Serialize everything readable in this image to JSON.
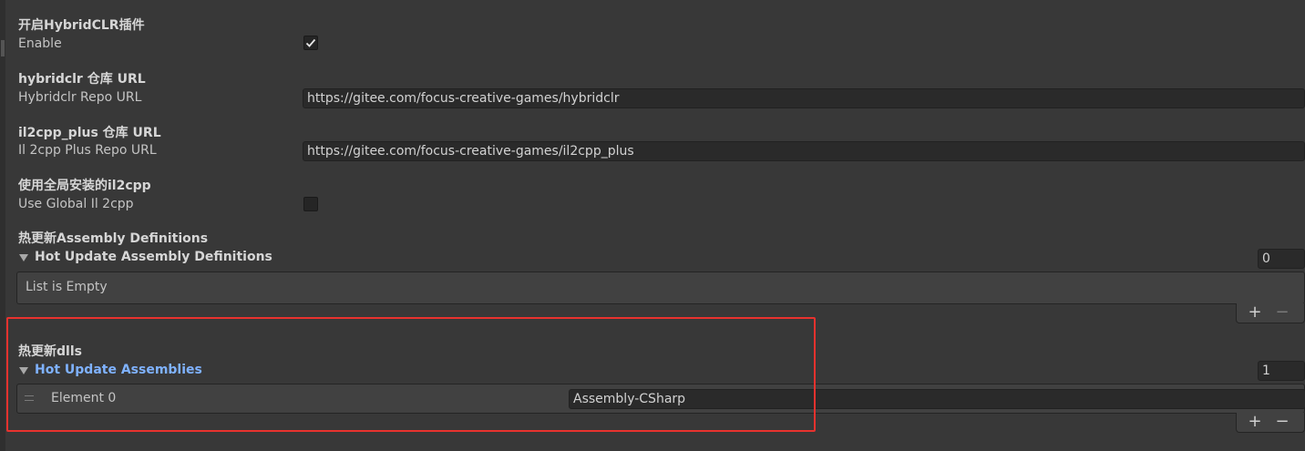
{
  "settings": {
    "enable": {
      "heading": "开启HybridCLR插件",
      "label": "Enable",
      "checked": true
    },
    "hybridclr_repo": {
      "heading": "hybridclr 仓库 URL",
      "label": "Hybridclr Repo URL",
      "value": "https://gitee.com/focus-creative-games/hybridclr"
    },
    "il2cpp_plus_repo": {
      "heading": "il2cpp_plus 仓库 URL",
      "label": "Il 2cpp Plus Repo URL",
      "value": "https://gitee.com/focus-creative-games/il2cpp_plus"
    },
    "use_global_il2cpp": {
      "heading": "使用全局安装的il2cpp",
      "label": "Use Global Il 2cpp",
      "checked": false
    },
    "assembly_definitions": {
      "heading": "热更新Assembly Definitions",
      "foldout_label": "Hot Update Assembly Definitions",
      "size": "0",
      "empty_text": "List is Empty",
      "add_label": "+",
      "remove_label": "−"
    },
    "hot_update_assemblies": {
      "heading": "热更新dlls",
      "foldout_label": "Hot Update Assemblies",
      "size": "1",
      "elements": [
        {
          "label": "Element 0",
          "value": "Assembly-CSharp"
        }
      ],
      "add_label": "+",
      "remove_label": "−"
    }
  },
  "colors": {
    "background": "#383838",
    "field_background": "#2a2a2a",
    "selected_label": "#7fb2ff",
    "highlight_border": "#e8322e"
  },
  "icons": [
    "checkmark-icon",
    "foldout-arrow-icon",
    "drag-handle-icon"
  ]
}
